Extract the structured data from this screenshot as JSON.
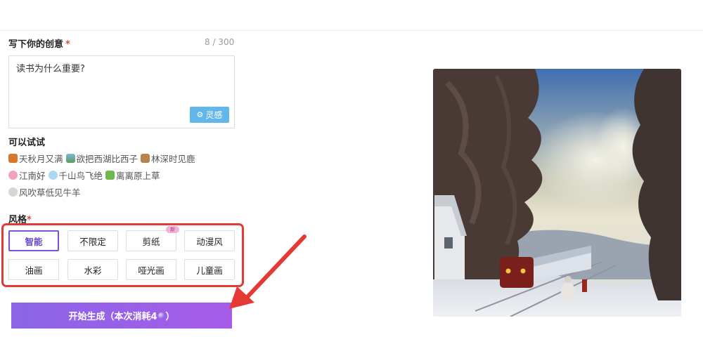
{
  "prompt": {
    "label": "写下你的创意",
    "required_mark": "*",
    "count": "8 / 300",
    "value": "读书为什么重要?",
    "inspire_icon": "gear-icon",
    "inspire_label": "灵感"
  },
  "suggestions": {
    "label": "可以试试",
    "rows": [
      [
        {
          "icon": "maple-leaf-icon",
          "text": "天秋月又满"
        },
        {
          "icon": "landscape-icon",
          "text": "欲把西湖比西子"
        },
        {
          "icon": "deer-icon",
          "text": "林深时见鹿"
        }
      ],
      [
        {
          "icon": "flower-icon",
          "text": "江南好"
        },
        {
          "icon": "snowflake-icon",
          "text": "千山鸟飞绝"
        },
        {
          "icon": "sprout-icon",
          "text": "离离原上草"
        }
      ],
      [
        {
          "icon": "sheep-icon",
          "text": "风吹草低见牛羊"
        }
      ]
    ]
  },
  "styles": {
    "label": "风格",
    "required_mark": "*",
    "selected": "智能",
    "new_badge": "新",
    "options": [
      "智能",
      "不限定",
      "剪纸",
      "动漫风",
      "油画",
      "水彩",
      "哑光画",
      "儿童画"
    ]
  },
  "generate": {
    "label_prefix": "开始生成（本次消耗4",
    "label_suffix": "）",
    "cost_icon": "gem-icon"
  },
  "preview": {
    "image": "generated-winter-train-painting"
  },
  "colors": {
    "accent_purple": "#7a52d9",
    "highlight_red": "#e33a35",
    "inspire_blue": "#62b6e8"
  }
}
